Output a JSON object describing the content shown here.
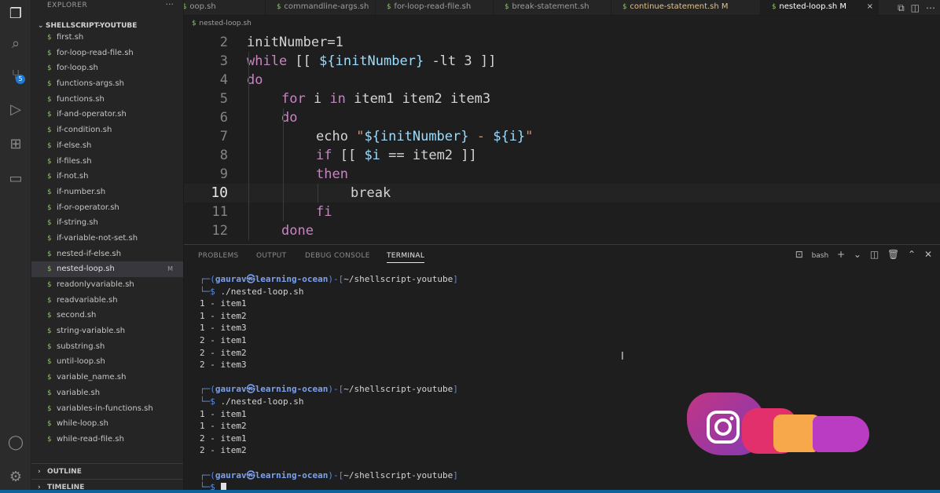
{
  "activity_bar": {
    "items": [
      "explorer-icon",
      "search-icon",
      "source-control-icon",
      "run-debug-icon",
      "extensions-icon",
      "remote-explorer-icon"
    ],
    "scm_badge": "5",
    "bottom_items": [
      "accounts-icon",
      "manage-gear-icon"
    ]
  },
  "sidebar": {
    "title": "EXPLORER",
    "more": "···",
    "folder": "SHELLSCRIPT-YOUTUBE",
    "files": [
      "first.sh",
      "for-loop-read-file.sh",
      "for-loop.sh",
      "functions-args.sh",
      "functions.sh",
      "if-and-operator.sh",
      "if-condition.sh",
      "if-else.sh",
      "if-files.sh",
      "if-not.sh",
      "if-number.sh",
      "if-or-operator.sh",
      "if-string.sh",
      "if-variable-not-set.sh",
      "nested-if-else.sh",
      "nested-loop.sh",
      "readonlyvariable.sh",
      "readvariable.sh",
      "second.sh",
      "string-variable.sh",
      "substring.sh",
      "until-loop.sh",
      "variable_name.sh",
      "variable.sh",
      "variables-in-functions.sh",
      "while-loop.sh",
      "while-read-file.sh"
    ],
    "selected_index": 15,
    "selected_mark": "M",
    "sections": [
      "OUTLINE",
      "TIMELINE"
    ]
  },
  "tabs": [
    {
      "label": "oop.sh",
      "state": "normal"
    },
    {
      "label": "commandline-args.sh",
      "state": "normal"
    },
    {
      "label": "for-loop-read-file.sh",
      "state": "normal"
    },
    {
      "label": "break-statement.sh",
      "state": "normal"
    },
    {
      "label": "continue-statement.sh M",
      "state": "modified"
    },
    {
      "label": "nested-loop.sh M",
      "state": "active"
    }
  ],
  "tab_close": "×",
  "breadcrumb": "nested-loop.sh",
  "editor": {
    "current_line": 10,
    "lines": [
      {
        "n": "2",
        "indent": 0,
        "tokens": [
          {
            "t": "initNumber=1",
            "c": "plain"
          }
        ]
      },
      {
        "n": "3",
        "indent": 0,
        "tokens": [
          {
            "t": "while",
            "c": "kw"
          },
          {
            "t": " [[ ",
            "c": "plain"
          },
          {
            "t": "${initNumber}",
            "c": "var"
          },
          {
            "t": " -lt 3 ]]",
            "c": "plain"
          }
        ]
      },
      {
        "n": "4",
        "indent": 0,
        "tokens": [
          {
            "t": "do",
            "c": "kw"
          }
        ]
      },
      {
        "n": "5",
        "indent": 1,
        "tokens": [
          {
            "t": "for",
            "c": "kw"
          },
          {
            "t": " i ",
            "c": "plain"
          },
          {
            "t": "in",
            "c": "kw"
          },
          {
            "t": " item1 item2 item3",
            "c": "plain"
          }
        ]
      },
      {
        "n": "6",
        "indent": 1,
        "tokens": [
          {
            "t": "do",
            "c": "kw"
          }
        ]
      },
      {
        "n": "7",
        "indent": 2,
        "tokens": [
          {
            "t": "echo ",
            "c": "plain"
          },
          {
            "t": "\"",
            "c": "str"
          },
          {
            "t": "${initNumber}",
            "c": "var"
          },
          {
            "t": " - ",
            "c": "str"
          },
          {
            "t": "${i}",
            "c": "var"
          },
          {
            "t": "\"",
            "c": "str"
          }
        ]
      },
      {
        "n": "8",
        "indent": 2,
        "tokens": [
          {
            "t": "if",
            "c": "kw"
          },
          {
            "t": " [[ ",
            "c": "plain"
          },
          {
            "t": "$i",
            "c": "var"
          },
          {
            "t": " == item2 ]]",
            "c": "plain"
          }
        ]
      },
      {
        "n": "9",
        "indent": 2,
        "tokens": [
          {
            "t": "then",
            "c": "kw"
          }
        ]
      },
      {
        "n": "10",
        "indent": 3,
        "tokens": [
          {
            "t": "break",
            "c": "plain"
          }
        ]
      },
      {
        "n": "11",
        "indent": 2,
        "tokens": [
          {
            "t": "fi",
            "c": "kw"
          }
        ]
      },
      {
        "n": "12",
        "indent": 1,
        "tokens": [
          {
            "t": "done",
            "c": "kw"
          }
        ]
      }
    ]
  },
  "panel": {
    "tabs": [
      "PROBLEMS",
      "OUTPUT",
      "DEBUG CONSOLE",
      "TERMINAL"
    ],
    "active_tab": "TERMINAL",
    "shell_label": "bash",
    "tools": [
      "+",
      "⌄",
      "◫",
      "🗑",
      "⌃",
      "✕"
    ]
  },
  "terminal": {
    "user": "gaurav",
    "host": "learning-ocean",
    "path": "~/shellscript-youtube",
    "blocks": [
      {
        "command": "./nested-loop.sh",
        "output": [
          "1 - item1",
          "1 - item2",
          "1 - item3",
          "2 - item1",
          "2 - item2",
          "2 - item3"
        ]
      },
      {
        "command": "./nested-loop.sh",
        "output": [
          "1 - item1",
          "1 - item2",
          "2 - item1",
          "2 - item2"
        ]
      },
      {
        "command": "",
        "output": []
      }
    ]
  },
  "colors": {
    "accent": "#0e639c",
    "keyword": "#c586c0",
    "variable": "#9cdcfe",
    "string": "#ce9178"
  }
}
